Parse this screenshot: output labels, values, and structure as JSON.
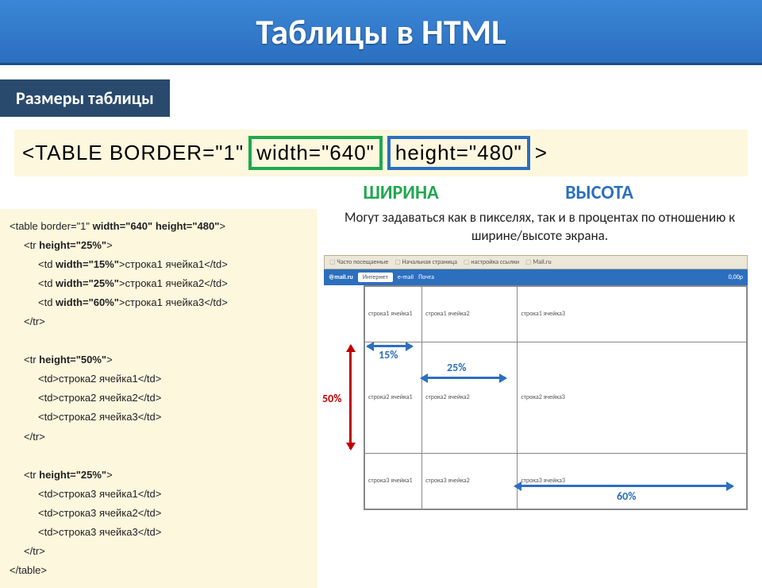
{
  "slide": {
    "title": "Таблицы в HTML",
    "subhead": "Размеры таблицы"
  },
  "tagline": {
    "prefix": "<TABLE BORDER=\"1\"",
    "width_attr": "width=\"640\"",
    "height_attr": "height=\"480\"",
    "suffix": ">"
  },
  "labels": {
    "width": "ШИРИНА",
    "height": "ВЫСОТА"
  },
  "description": "Могут задаваться как в пикселях, так и в процентах по отношению к ширине/высоте экрана.",
  "code": [
    {
      "indent": 0,
      "text": "<table border=\"1\" width=\"640\" height=\"480\">"
    },
    {
      "indent": 1,
      "text": "<tr height=\"25%\">"
    },
    {
      "indent": 2,
      "text": "<td width=\"15%\">строка1 ячейка1</td>"
    },
    {
      "indent": 2,
      "text": "<td width=\"25%\">строка1 ячейка2</td>"
    },
    {
      "indent": 2,
      "text": "<td width=\"60%\">строка1 ячейка3</td>"
    },
    {
      "indent": 1,
      "text": "</tr>"
    },
    {
      "indent": 0,
      "text": ""
    },
    {
      "indent": 1,
      "text": "<tr height=\"50%\">"
    },
    {
      "indent": 2,
      "text": "<td>строка2 ячейка1</td>"
    },
    {
      "indent": 2,
      "text": "<td>строка2 ячейка2</td>"
    },
    {
      "indent": 2,
      "text": "<td>строка2 ячейка3</td>"
    },
    {
      "indent": 1,
      "text": "</tr>"
    },
    {
      "indent": 0,
      "text": ""
    },
    {
      "indent": 1,
      "text": "<tr height=\"25%\">"
    },
    {
      "indent": 2,
      "text": "<td>строка3 ячейка1</td>"
    },
    {
      "indent": 2,
      "text": "<td>строка3 ячейка2</td>"
    },
    {
      "indent": 2,
      "text": "<td>строка3 ячейка3</td>"
    },
    {
      "indent": 1,
      "text": "</tr>"
    },
    {
      "indent": 0,
      "text": "</table>"
    }
  ],
  "bookmarks": [
    "Часто посещаемые",
    "Начальная страница",
    "настройка ссылки",
    "Mail.ru"
  ],
  "mailbar": {
    "logo": "@mail.ru",
    "items": [
      "Интернет",
      "e-mail",
      "Почта",
      "0,00р"
    ]
  },
  "demo_table": {
    "rows": [
      {
        "h": "25%",
        "cells": [
          "строка1 ячейка1",
          "строка1 ячейка2",
          "строка1 ячейка3"
        ]
      },
      {
        "h": "50%",
        "cells": [
          "строка2 ячейка1",
          "строка2 ячейка2",
          "строка2 ячейка3"
        ]
      },
      {
        "h": "25%",
        "cells": [
          "строка3 ячейка1",
          "строка3 ячейка2",
          "строка3 ячейка3"
        ]
      }
    ],
    "col_widths": [
      "15%",
      "25%",
      "60%"
    ]
  },
  "percent_labels": {
    "c15": "15%",
    "c25": "25%",
    "c60": "60%",
    "r50": "50%"
  }
}
